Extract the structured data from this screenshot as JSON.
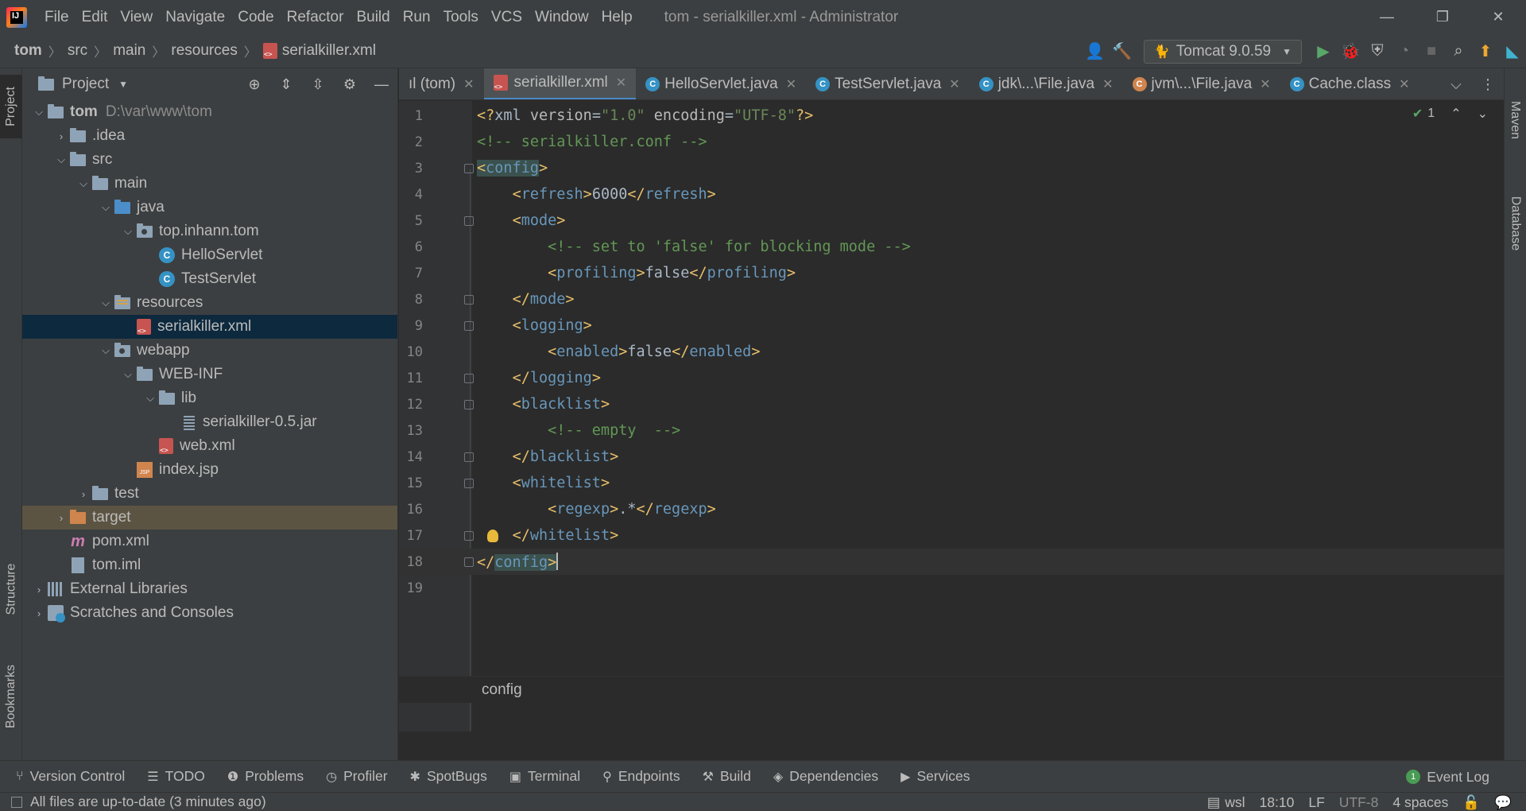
{
  "window": {
    "title": "tom - serialkiller.xml - Administrator",
    "menu": [
      "File",
      "Edit",
      "View",
      "Navigate",
      "Code",
      "Refactor",
      "Build",
      "Run",
      "Tools",
      "VCS",
      "Window",
      "Help"
    ],
    "controls": {
      "minimize": "—",
      "restore": "❐",
      "close": "✕"
    }
  },
  "breadcrumb": [
    "tom",
    "src",
    "main",
    "resources",
    "serialkiller.xml"
  ],
  "run_config": {
    "label": "Tomcat 9.0.59"
  },
  "left_strip": {
    "project": "Project",
    "structure": "Structure",
    "bookmarks": "Bookmarks"
  },
  "right_strip": {
    "maven": "Maven",
    "database": "Database"
  },
  "project_panel": {
    "title": "Project",
    "tree": [
      {
        "label": "tom",
        "extra": "D:\\var\\www\\tom"
      },
      {
        "label": ".idea"
      },
      {
        "label": "src"
      },
      {
        "label": "main"
      },
      {
        "label": "java"
      },
      {
        "label": "top.inhann.tom"
      },
      {
        "label": "HelloServlet"
      },
      {
        "label": "TestServlet"
      },
      {
        "label": "resources"
      },
      {
        "label": "serialkiller.xml"
      },
      {
        "label": "webapp"
      },
      {
        "label": "WEB-INF"
      },
      {
        "label": "lib"
      },
      {
        "label": "serialkiller-0.5.jar"
      },
      {
        "label": "web.xml"
      },
      {
        "label": "index.jsp"
      },
      {
        "label": "test"
      },
      {
        "label": "target"
      },
      {
        "label": "pom.xml"
      },
      {
        "label": "tom.iml"
      },
      {
        "label": "External Libraries"
      },
      {
        "label": "Scratches and Consoles"
      }
    ]
  },
  "tabs": [
    {
      "label": "ıl (tom)"
    },
    {
      "label": "serialkiller.xml"
    },
    {
      "label": "HelloServlet.java"
    },
    {
      "label": "TestServlet.java"
    },
    {
      "label": "jdk\\...\\File.java"
    },
    {
      "label": "jvm\\...\\File.java"
    },
    {
      "label": "Cache.class"
    }
  ],
  "editor": {
    "inspection_count": "1",
    "line_numbers": [
      "1",
      "2",
      "3",
      "4",
      "5",
      "6",
      "7",
      "8",
      "9",
      "10",
      "11",
      "12",
      "13",
      "14",
      "15",
      "16",
      "17",
      "18",
      "19"
    ],
    "lines": [
      "<?xml version=\"1.0\" encoding=\"UTF-8\"?>",
      "<!-- serialkiller.conf -->",
      "<config>",
      "    <refresh>6000</refresh>",
      "    <mode>",
      "        <!-- set to 'false' for blocking mode -->",
      "        <profiling>false</profiling>",
      "    </mode>",
      "    <logging>",
      "        <enabled>false</enabled>",
      "    </logging>",
      "    <blacklist>",
      "        <!-- empty  -->",
      "    </blacklist>",
      "    <whitelist>",
      "        <regexp>.*</regexp>",
      "    </whitelist>",
      "</config>",
      ""
    ],
    "breadcrumb": "config"
  },
  "tool_windows": [
    "Version Control",
    "TODO",
    "Problems",
    "Profiler",
    "SpotBugs",
    "Terminal",
    "Endpoints",
    "Build",
    "Dependencies",
    "Services"
  ],
  "event_log": {
    "label": "Event Log",
    "count": "1"
  },
  "status": {
    "message": "All files are up-to-date (3 minutes ago)",
    "wsl": "wsl",
    "position": "18:10",
    "line_sep": "LF",
    "encoding": "UTF-8",
    "indent": "4 spaces"
  }
}
